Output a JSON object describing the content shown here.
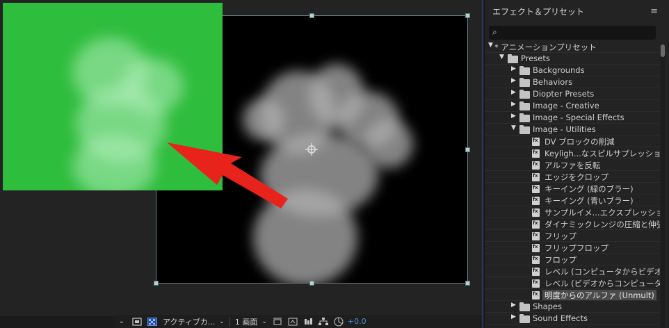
{
  "viewer": {
    "toolbar": {
      "camera_label": "アクティブカ...",
      "view_label": "1 画面",
      "exposure": "+0.0"
    }
  },
  "effects_panel": {
    "title": "エフェクト＆プリセット",
    "search": {
      "placeholder": "",
      "value": ""
    },
    "tree": {
      "root": "* アニメーションプリセット",
      "presets": "Presets",
      "folders_before": [
        "Backgrounds",
        "Behaviors",
        "Diopter Presets",
        "Image - Creative",
        "Image - Special Effects"
      ],
      "open_folder": "Image - Utilities",
      "utility_presets": [
        "DV ブロックの削減",
        "Keyligh...なスピルサプレッション",
        "アルファを反転",
        "エッジをクロップ",
        "キーイング (緑のブラー)",
        "キーイング (青いブラー)",
        "サンプルイメ...エクスプレッション",
        "ダイナミックレンジの圧縮と伸張",
        "フリップ",
        "フリップフロップ",
        "フロップ",
        "レベル (コンピュータからビデオ)",
        "レベル (ビデオからコンピュータ)",
        "明度からのアルファ (Unmult)"
      ],
      "selected_index": 13,
      "folders_after": [
        "Shapes",
        "Sound Effects"
      ]
    }
  },
  "colors": {
    "green_screen": "#2fbd3d",
    "arrow": "#e8231b",
    "accent": "#2d68c4",
    "exposure": "#4e8fd6"
  }
}
